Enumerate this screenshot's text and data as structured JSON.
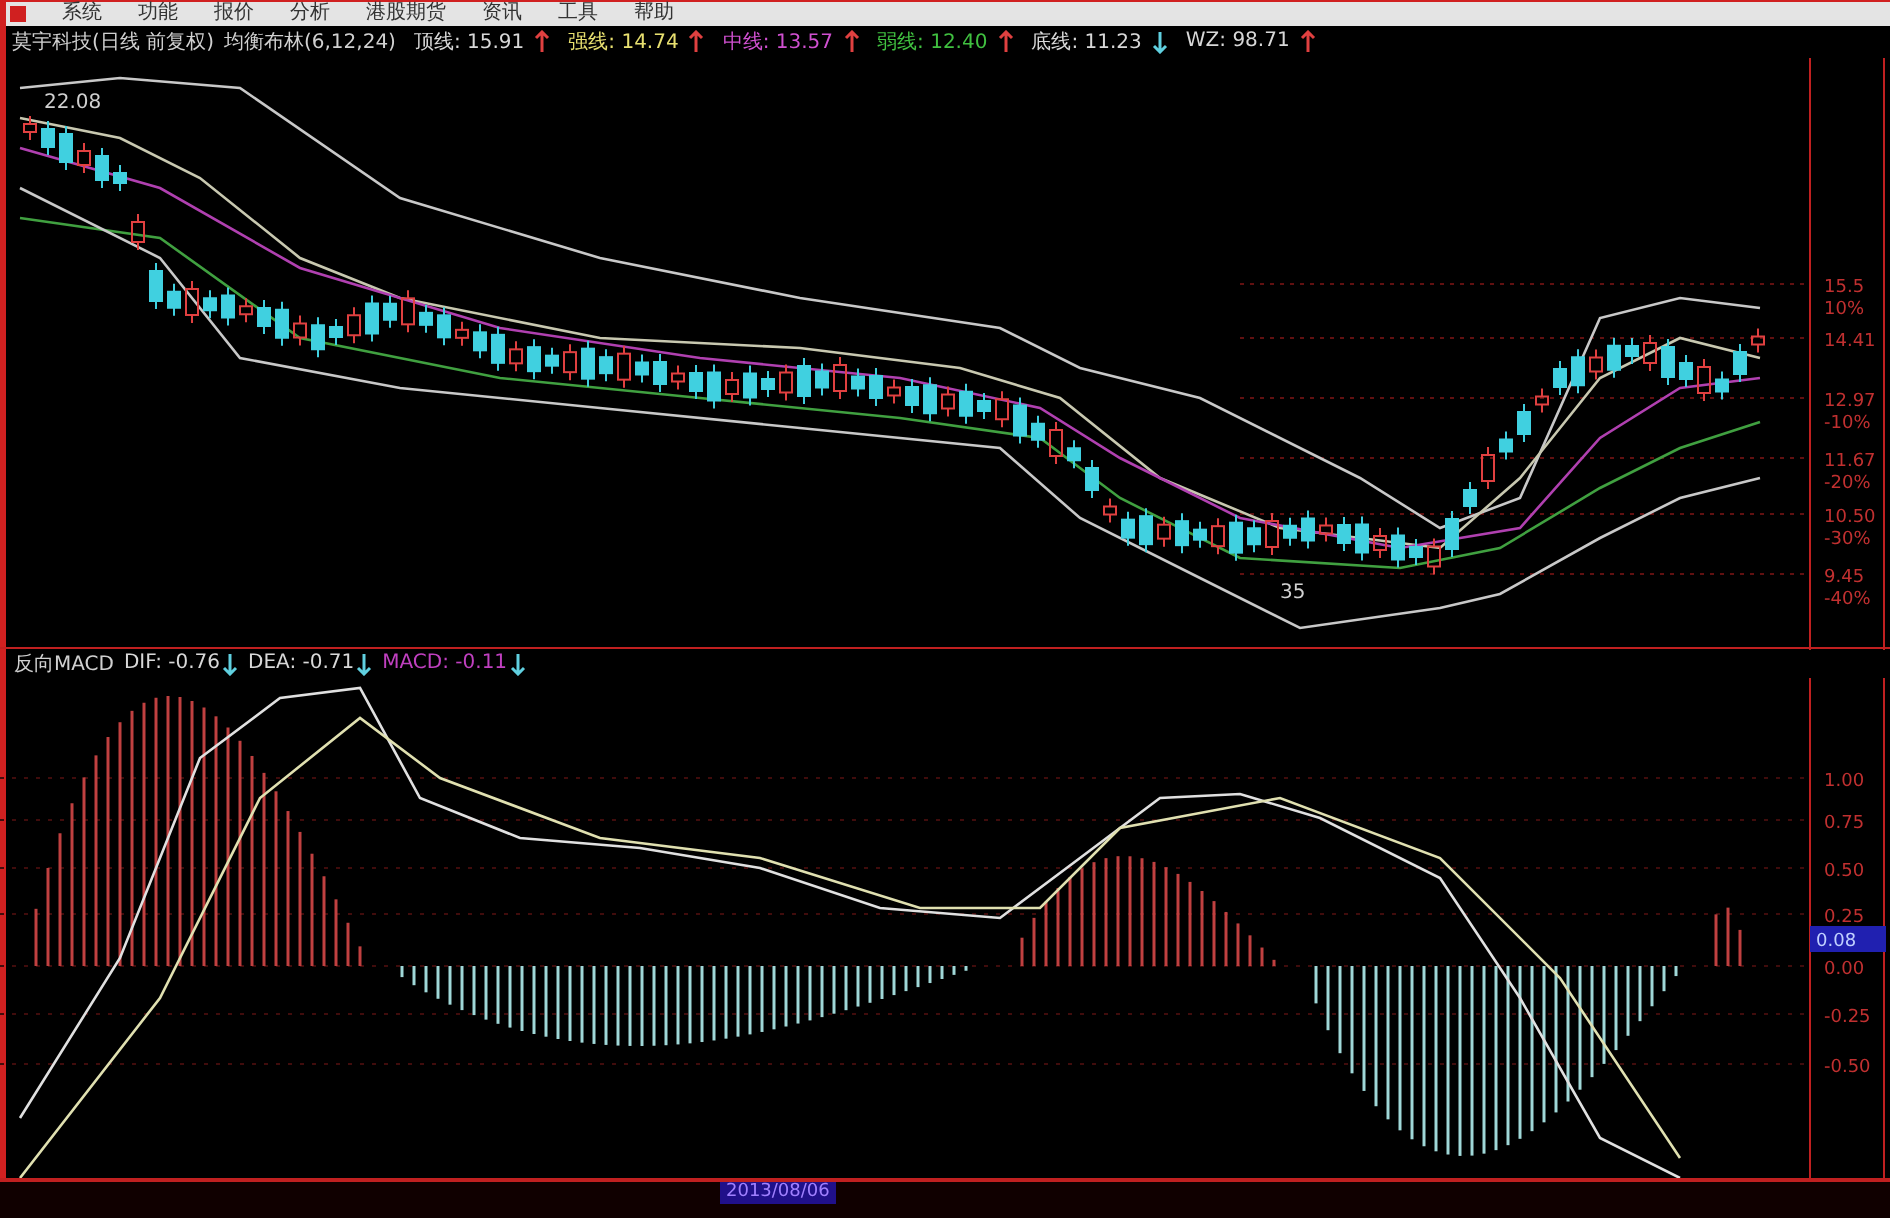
{
  "menu_bar": {
    "items": [
      "系统",
      "功能",
      "报价",
      "分析",
      "港股期货",
      "资讯",
      "工具",
      "帮助"
    ]
  },
  "info_bar": {
    "title": "莫宇科技(日线 前复权)",
    "indicator": "均衡布林(6,12,24)",
    "values": [
      {
        "label": "顶线:",
        "value": "15.91",
        "rising": true,
        "color": "#d8d8d8"
      },
      {
        "label": "强线:",
        "value": "14.74",
        "rising": true,
        "color": "#e8e070"
      },
      {
        "label": "中线:",
        "value": "13.57",
        "rising": true,
        "color": "#d050d0"
      },
      {
        "label": "弱线:",
        "value": "12.40",
        "rising": true,
        "color": "#40c040"
      },
      {
        "label": "底线:",
        "value": "11.23",
        "rising": false,
        "color": "#d8d8d8"
      },
      {
        "label": "WZ:",
        "value": "98.71",
        "rising": true,
        "color": "#d8d8d8"
      }
    ]
  },
  "price_chart": {
    "annotations": [
      "22.08",
      "35"
    ],
    "axis_labels": [
      {
        "price": "15.5",
        "percent": "10%"
      },
      {
        "price": "14.41"
      },
      {
        "price": "12.97",
        "percent": "-10%"
      },
      {
        "price": "11.67",
        "percent": "-20%"
      },
      {
        "price": "10.50",
        "percent": "-30%"
      },
      {
        "price": "9.45",
        "percent": "-40%"
      }
    ]
  },
  "macd_panel": {
    "title": "反向MACD",
    "values": [
      {
        "label": "DIF:",
        "value": "-0.76",
        "rising": false,
        "color": "#d8d8d8"
      },
      {
        "label": "DEA:",
        "value": "-0.71",
        "rising": false,
        "color": "#d8d8d8"
      },
      {
        "label": "MACD:",
        "value": "-0.11",
        "rising": false,
        "color": "#c040c0"
      }
    ],
    "axis_labels": [
      "1.00",
      "0.75",
      "0.50",
      "0.25",
      "0.00",
      "-0.25",
      "-0.50"
    ],
    "current_value": "0.08"
  },
  "date_axis": {
    "label": "2013/08/06"
  }
}
